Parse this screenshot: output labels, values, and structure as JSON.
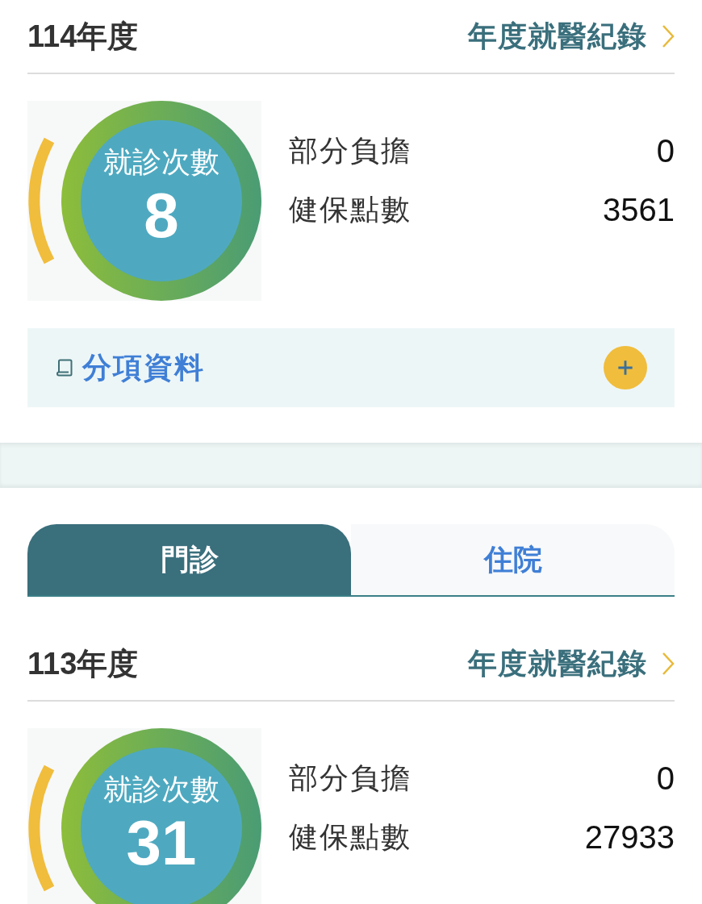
{
  "summary_top": {
    "title": "114年度",
    "link": "年度就醫紀錄",
    "visits_label": "就診次數",
    "visits": "8",
    "stats": [
      {
        "label": "部分負擔",
        "value": "0"
      },
      {
        "label": "健保點數",
        "value": "3561"
      }
    ],
    "detail": {
      "label": "分項資料",
      "expanded": false
    }
  },
  "tabs": [
    {
      "label": "門診",
      "selected": true
    },
    {
      "label": "住院",
      "selected": false
    }
  ],
  "summary_bottom": {
    "title": "113年度",
    "link": "年度就醫紀錄",
    "visits_label": "就診次數",
    "visits": "31",
    "stats": [
      {
        "label": "部分負擔",
        "value": "0"
      },
      {
        "label": "健保點數",
        "value": "27933"
      }
    ]
  }
}
